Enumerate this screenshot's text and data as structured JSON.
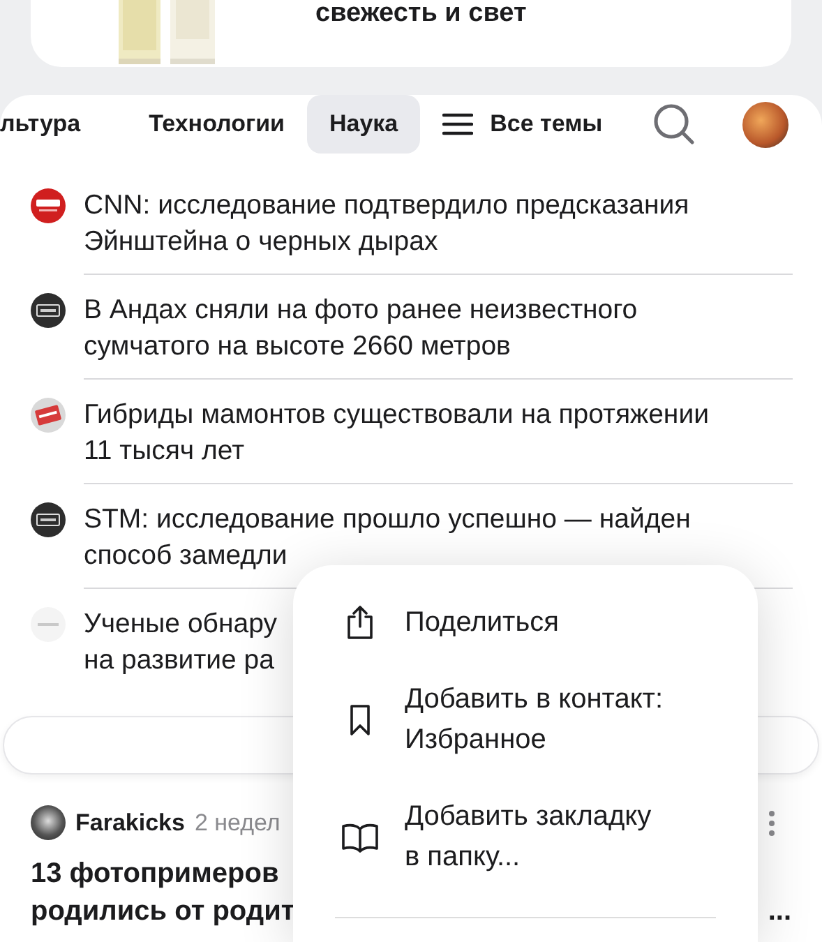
{
  "promo": {
    "text": "свежесть и свет"
  },
  "tabs": [
    {
      "label": "льтура",
      "selected": false
    },
    {
      "label": "Технологии",
      "selected": false
    },
    {
      "label": "Наука",
      "selected": true
    }
  ],
  "all_topics": {
    "label": "Все темы"
  },
  "news": [
    {
      "kind": "red",
      "lines": [
        "CNN: исследование подтвердило предсказания",
        "Эйнштейна о черных дырах"
      ]
    },
    {
      "kind": "dark",
      "lines": [
        "В Андах сняли на фото ранее неизвестного",
        "сумчатого на высоте 2660 метров"
      ]
    },
    {
      "kind": "striped",
      "lines": [
        "Гибриды мамонтов существовали на протяжении",
        "11 тысяч лет"
      ]
    },
    {
      "kind": "dark",
      "lines": [
        "STM: исследование прошло успешно — найден",
        "способ замедли"
      ]
    },
    {
      "kind": "pale",
      "lines": [
        "Ученые обнару",
        "на развитие ра"
      ]
    }
  ],
  "post": {
    "author": "Farakicks",
    "time": "2 недел",
    "title_lines": [
      "13 фотопримеров",
      "родились от родит"
    ],
    "title_tail": "..."
  },
  "menu": {
    "items": [
      {
        "kind": "share",
        "lines": [
          "Поделиться"
        ]
      },
      {
        "kind": "bookmark",
        "lines": [
          "Добавить в контакт:",
          "Избранное"
        ]
      },
      {
        "kind": "book",
        "lines": [
          "Добавить закладку",
          "в папку..."
        ]
      }
    ]
  }
}
